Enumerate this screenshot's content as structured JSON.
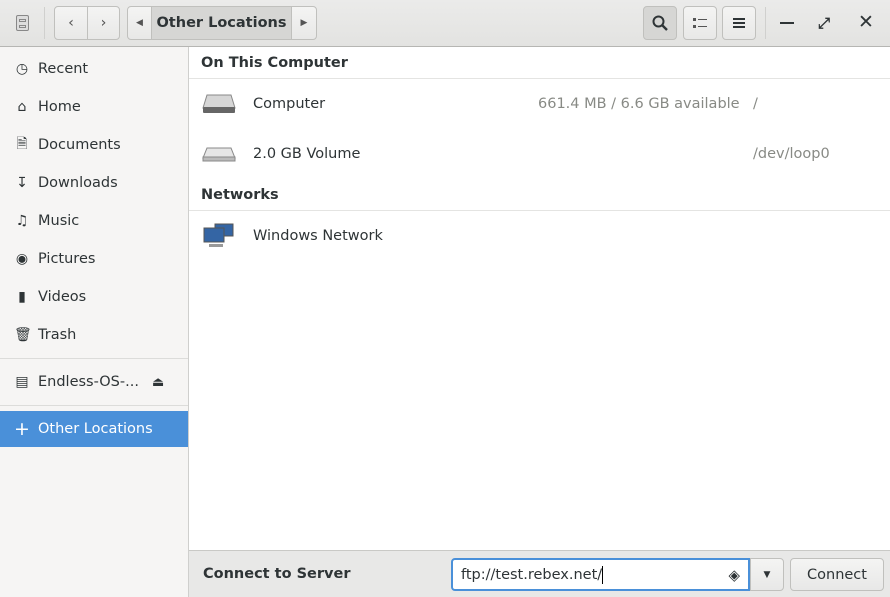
{
  "titlebar": {
    "path_label": "Other Locations",
    "icons": [
      "file-cabinet-icon",
      "back-icon",
      "forward-icon",
      "path-left-icon",
      "path-right-icon",
      "search-icon",
      "view-list-icon",
      "menu-icon",
      "minimize-icon",
      "maximize-icon",
      "close-icon"
    ]
  },
  "sidebar": {
    "items": [
      {
        "label": "Recent",
        "icon": "clock-icon"
      },
      {
        "label": "Home",
        "icon": "home-icon"
      },
      {
        "label": "Documents",
        "icon": "document-icon"
      },
      {
        "label": "Downloads",
        "icon": "download-icon"
      },
      {
        "label": "Music",
        "icon": "music-icon"
      },
      {
        "label": "Pictures",
        "icon": "camera-icon"
      },
      {
        "label": "Videos",
        "icon": "video-icon"
      },
      {
        "label": "Trash",
        "icon": "trash-icon"
      }
    ],
    "device": {
      "label": "Endless-OS-...",
      "icon": "drive-icon"
    },
    "other": {
      "label": "Other Locations",
      "icon": "plus-icon"
    },
    "accent": "#4a90d9"
  },
  "main": {
    "on_this_computer": "On This Computer",
    "computer": {
      "name": "Computer",
      "space": "661.4 MB / 6.6 GB available",
      "path": "/"
    },
    "volume": {
      "name": "2.0 GB Volume",
      "path": "/dev/loop0"
    },
    "networks": "Networks",
    "windows_network": "Windows Network"
  },
  "bottom": {
    "label": "Connect to Server",
    "server_value": "ftp://test.rebex.net/",
    "connect": "Connect"
  }
}
